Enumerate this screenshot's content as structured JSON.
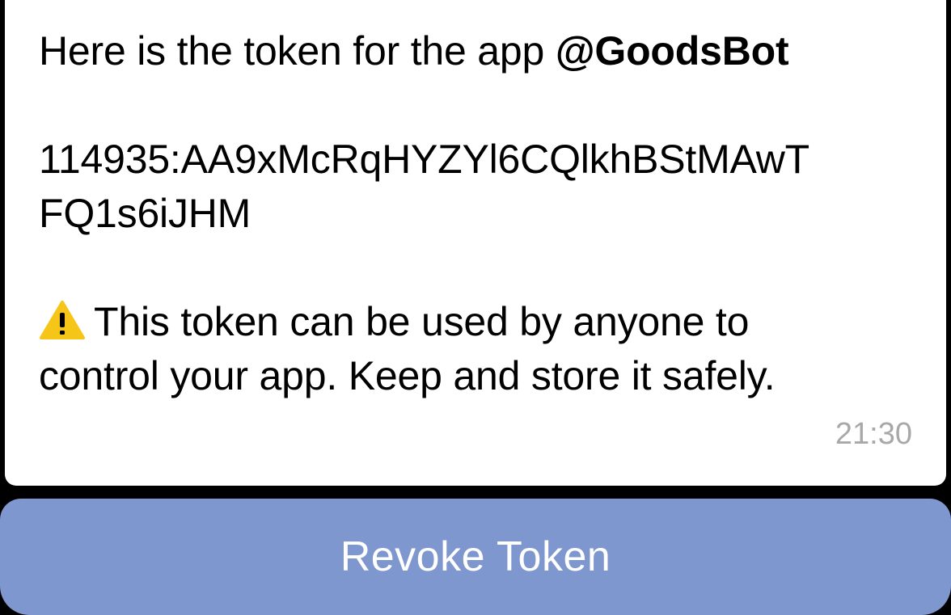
{
  "message": {
    "intro_prefix": "Here is the token for the app ",
    "bot_name": "@GoodsBot",
    "token_line1": "114935:AA9xMcRqHYZYl6CQlkhBStMAwT",
    "token_line2": "FQ1s6iJHM",
    "warning_icon": "warning-icon",
    "warning_line1": "This token can be used by anyone to",
    "warning_line2": "control your app. Keep and store it safely.",
    "time": "21:30"
  },
  "actions": {
    "revoke_label": "Revoke Token"
  },
  "colors": {
    "bubble": "#ffffff",
    "button": "#7f97cf",
    "time": "#a8a8a8",
    "warning": "#f5c518"
  }
}
